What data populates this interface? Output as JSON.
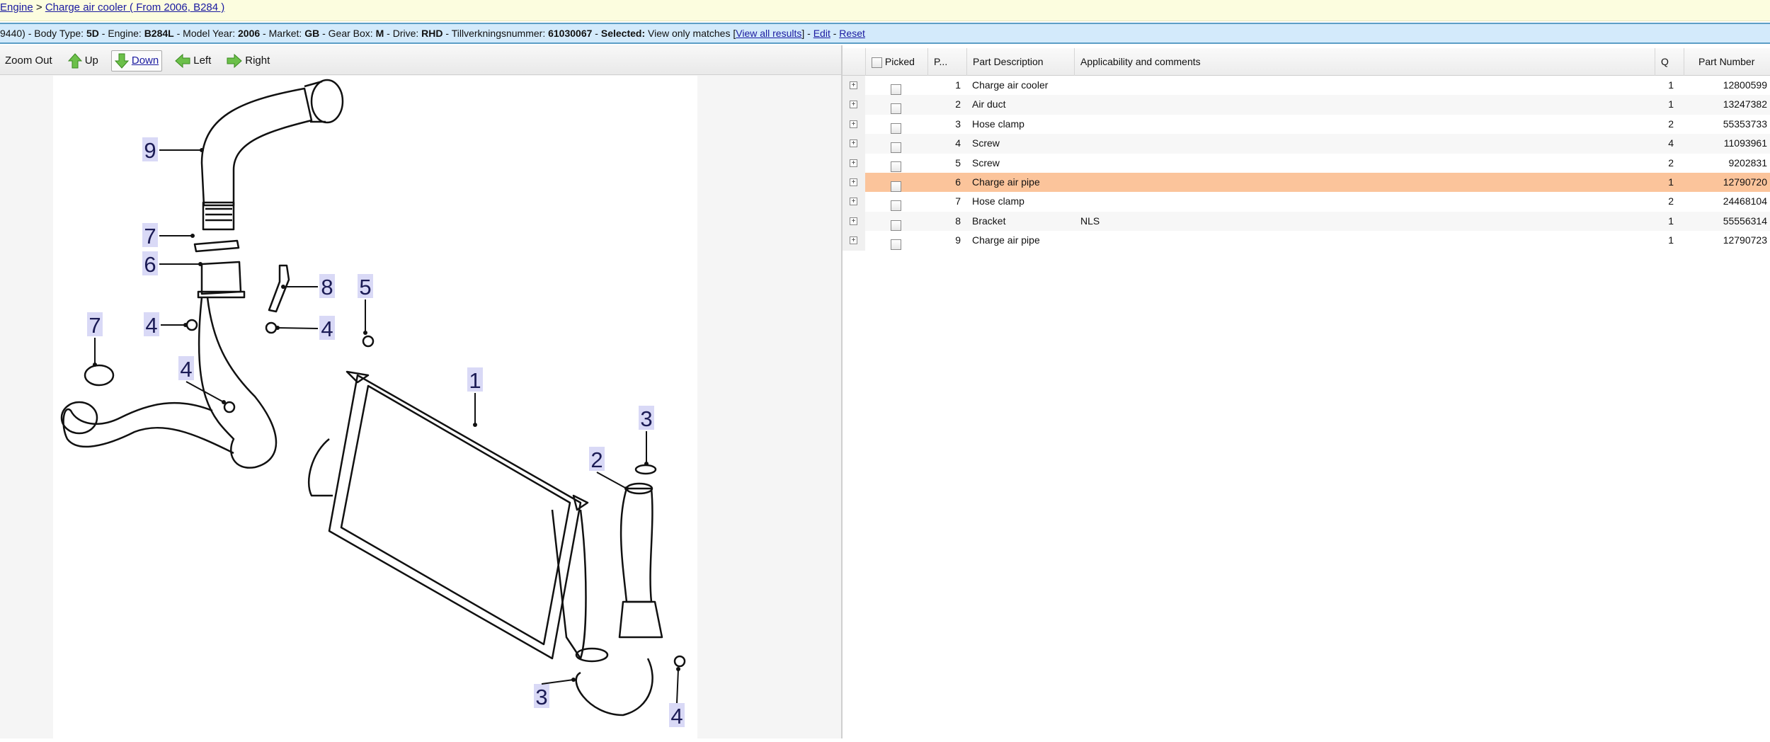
{
  "breadcrumb": {
    "items": [
      "Engine",
      "Charge air cooler ( From 2006, B284 )"
    ],
    "separator": " > "
  },
  "vehicle_info": {
    "prefix": "9440)",
    "fields": [
      {
        "label": "Body Type:",
        "value": "5D"
      },
      {
        "label": "Engine:",
        "value": "B284L"
      },
      {
        "label": "Model Year:",
        "value": "2006"
      },
      {
        "label": "Market:",
        "value": "GB"
      },
      {
        "label": "Gear Box:",
        "value": "M"
      },
      {
        "label": "Drive:",
        "value": "RHD"
      },
      {
        "label": "Tillverkningsnummer:",
        "value": "61030067"
      }
    ],
    "selected_label": "Selected:",
    "selected_value": "View only matches",
    "view_all": "View all results",
    "edit": "Edit",
    "reset": "Reset"
  },
  "toolbar": {
    "zoom_out": "Zoom Out",
    "up": "Up",
    "down": "Down",
    "left": "Left",
    "right": "Right"
  },
  "diagram": {
    "callouts": [
      "9",
      "7",
      "6",
      "8",
      "5",
      "7",
      "4",
      "4",
      "4",
      "1",
      "3",
      "2",
      "3",
      "4"
    ]
  },
  "table": {
    "headers": {
      "picked": "Picked",
      "pos": "P...",
      "description": "Part Description",
      "applicability": "Applicability and comments",
      "qty": "Q",
      "part_number": "Part Number"
    },
    "selected_color": "#fbc49b",
    "rows": [
      {
        "pos": "1",
        "description": "Charge air cooler",
        "applicability": "",
        "qty": "1",
        "part_number": "12800599"
      },
      {
        "pos": "2",
        "description": "Air duct",
        "applicability": "",
        "qty": "1",
        "part_number": "13247382"
      },
      {
        "pos": "3",
        "description": "Hose clamp",
        "applicability": "",
        "qty": "2",
        "part_number": "55353733"
      },
      {
        "pos": "4",
        "description": "Screw",
        "applicability": "",
        "qty": "4",
        "part_number": "11093961"
      },
      {
        "pos": "5",
        "description": "Screw",
        "applicability": "",
        "qty": "2",
        "part_number": "9202831"
      },
      {
        "pos": "6",
        "description": "Charge air pipe",
        "applicability": "",
        "qty": "1",
        "part_number": "12790720",
        "selected": true
      },
      {
        "pos": "7",
        "description": "Hose clamp",
        "applicability": "",
        "qty": "2",
        "part_number": "24468104"
      },
      {
        "pos": "8",
        "description": "Bracket",
        "applicability": "NLS",
        "qty": "1",
        "part_number": "55556314"
      },
      {
        "pos": "9",
        "description": "Charge air pipe",
        "applicability": "",
        "qty": "1",
        "part_number": "12790723"
      }
    ]
  }
}
